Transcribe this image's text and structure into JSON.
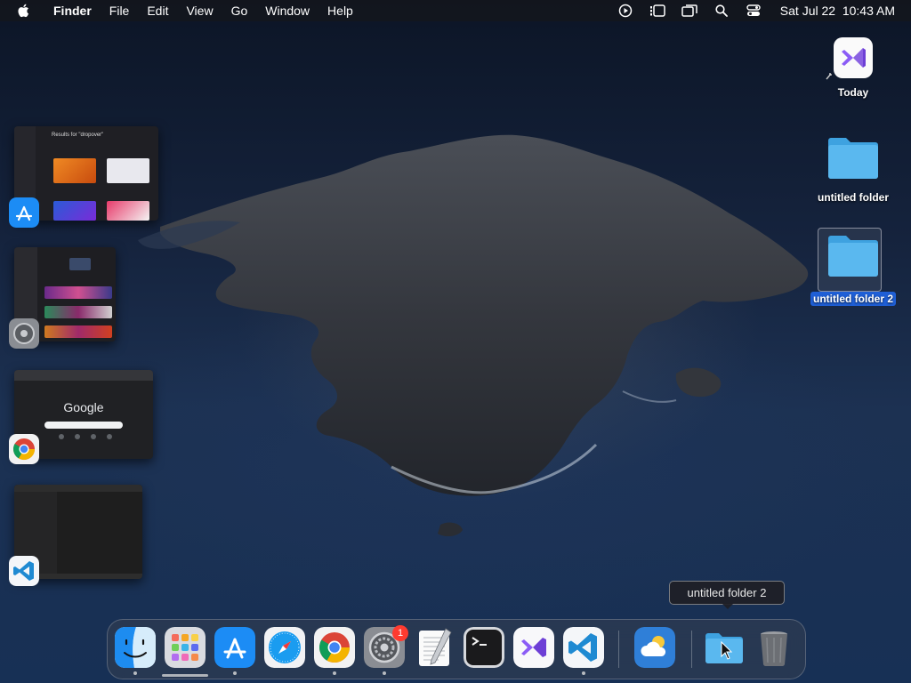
{
  "menubar": {
    "app_name": "Finder",
    "items": [
      "File",
      "Edit",
      "View",
      "Go",
      "Window",
      "Help"
    ],
    "status_icons": [
      "play-circle-icon",
      "stage-manager-icon",
      "screen-mirroring-icon",
      "search-icon",
      "control-center-icon"
    ],
    "clock": "Sat Jul 22  10:43 AM"
  },
  "desktop": {
    "icons": [
      {
        "label": "Today",
        "kind": "visual-studio-file-icon",
        "selected": false
      },
      {
        "label": "untitled folder",
        "kind": "folder-icon",
        "selected": false
      },
      {
        "label": "untitled folder 2",
        "kind": "folder-icon",
        "selected": true
      }
    ]
  },
  "stage_manager": {
    "groups": [
      {
        "app": "app-store-icon",
        "thumb_title": "Results for \"dropover\""
      },
      {
        "app": "system-settings-icon",
        "thumb_title": ""
      },
      {
        "app": "chrome-icon",
        "thumb_title": "Google"
      },
      {
        "app": "vscode-icon",
        "thumb_title": ""
      }
    ]
  },
  "dock": {
    "items": [
      {
        "name": "finder-icon",
        "running": true
      },
      {
        "name": "launchpad-icon",
        "running": false
      },
      {
        "name": "app-store-icon",
        "running": true
      },
      {
        "name": "safari-icon",
        "running": false
      },
      {
        "name": "chrome-icon",
        "running": true
      },
      {
        "name": "system-settings-icon",
        "running": true,
        "badge": "1"
      },
      {
        "name": "textedit-icon",
        "running": false
      },
      {
        "name": "terminal-icon",
        "running": false
      },
      {
        "name": "visual-studio-icon",
        "running": false
      },
      {
        "name": "vscode-icon",
        "running": true
      },
      {
        "name": "weather-icon",
        "running": false
      },
      {
        "name": "downloads-folder-icon",
        "running": false
      },
      {
        "name": "trash-icon",
        "running": false
      }
    ],
    "tooltip": "untitled folder 2"
  },
  "colors": {
    "selection": "#1f5fd6",
    "folder_blue": "#5ab8ef",
    "badge_red": "#ff3b30"
  }
}
